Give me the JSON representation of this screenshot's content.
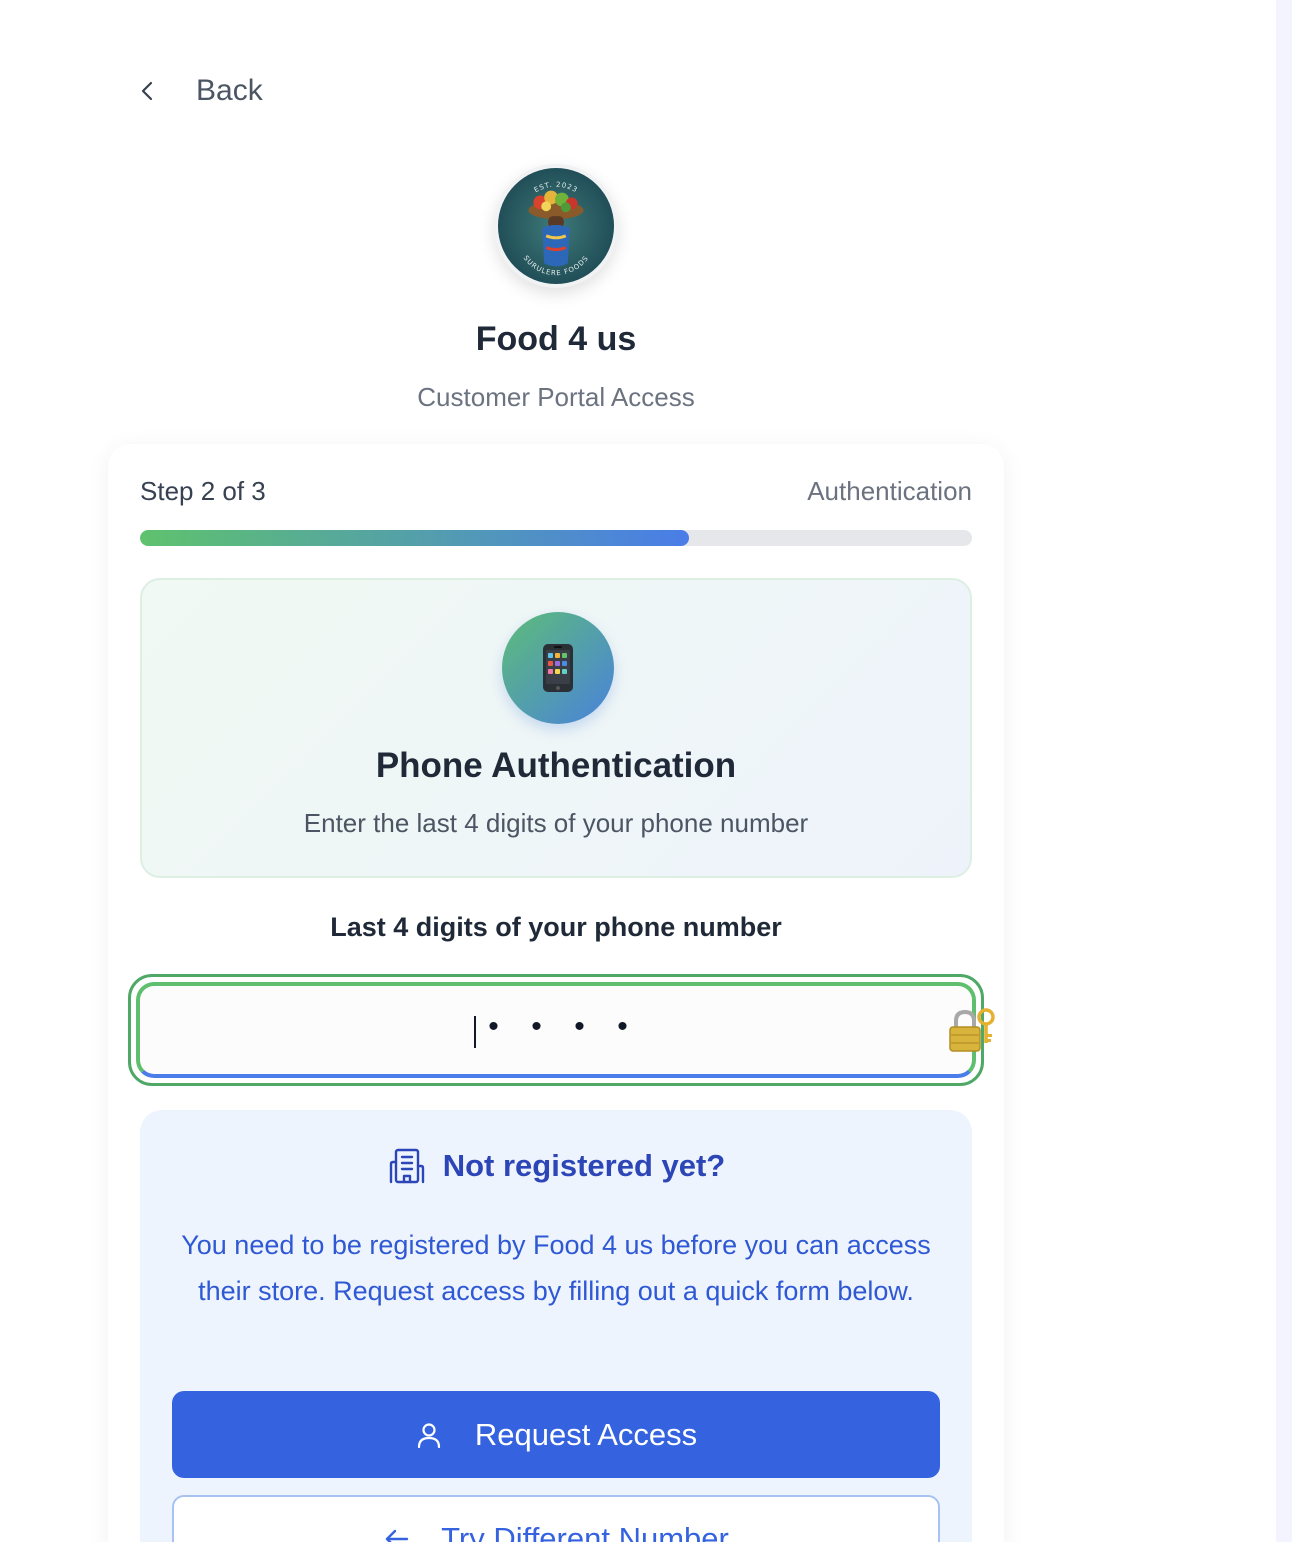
{
  "nav": {
    "back_label": "Back"
  },
  "store": {
    "name": "Food 4 us",
    "subtitle": "Customer Portal Access",
    "logo_text_top": "EST. 2023",
    "logo_text_bottom": "SURULERE FOODS"
  },
  "progress": {
    "step_label": "Step 2 of 3",
    "step_name": "Authentication",
    "fraction": 0.66
  },
  "auth": {
    "icon": "mobile-phone-icon",
    "title": "Phone Authentication",
    "subtitle": "Enter the last 4 digits of your phone number"
  },
  "pin": {
    "label": "Last 4 digits of your phone number",
    "placeholder_dots": [
      "•",
      "•",
      "•",
      "•"
    ],
    "lock_icon": "lock-with-key-icon"
  },
  "register": {
    "icon": "building-icon",
    "title": "Not registered yet?",
    "text": "You need to be registered by Food 4 us before you can access their store. Request access by filling out a quick form below.",
    "request_label": "Request Access",
    "request_icon": "user-icon",
    "try_label": "Try Different Number",
    "try_icon": "arrow-left-icon"
  },
  "colors": {
    "primary": "#3563e0",
    "success": "#5fbf6e",
    "text_dark": "#1f2937",
    "muted": "#6b7280"
  }
}
